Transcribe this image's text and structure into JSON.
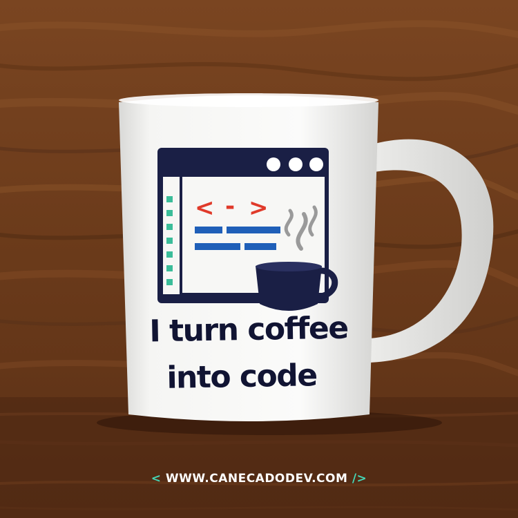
{
  "mug": {
    "slogan_line1": "I turn coffee",
    "slogan_line2": "into code",
    "code_glyph_left": "<",
    "code_glyph_mid": "-",
    "code_glyph_right": ">"
  },
  "watermark": {
    "open": "<",
    "text": "WWW.CANECADODEV.COM",
    "close": "/>"
  },
  "colors": {
    "wood": "#6e3d1c",
    "mug_white": "#f4f4f2",
    "navy": "#1a1f45",
    "red": "#e03a2a",
    "blue": "#1f5fb8",
    "teal": "#3bbd9a",
    "steam": "#9a9a9a",
    "watermark_accent": "#45d6b6"
  }
}
